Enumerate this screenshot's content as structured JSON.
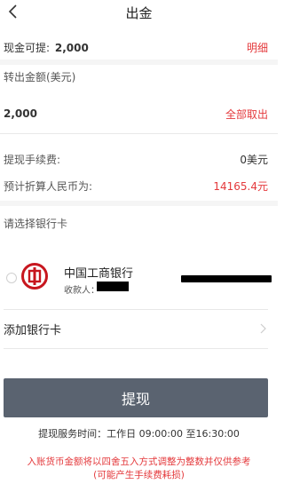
{
  "header": {
    "title": "出金"
  },
  "cash_row": {
    "label": "现金可提:",
    "amount": "2,000",
    "detail_link": "明细"
  },
  "transfer_amount": {
    "label": "转出金额(美元)",
    "value": "2,000",
    "withdraw_all": "全部取出"
  },
  "fee_row": {
    "label": "提现手续费:",
    "value": "0美元"
  },
  "rmb_row": {
    "label": "预计折算人民币为:",
    "value": "14165.4元"
  },
  "bank_section": {
    "label": "请选择银行卡"
  },
  "bank_card": {
    "name": "中国工商银行",
    "payee_label": "收款人："
  },
  "add_card": {
    "label": "添加银行卡"
  },
  "submit": {
    "label": "提现"
  },
  "notes": {
    "service_time": "提现服务时间：工作日 09:00:00 至16:30:00",
    "rounding_line1": "入账货币金额将以四舍五入方式调整为整数并仅供参考",
    "rounding_line2": "(可能产生手续费耗损)"
  },
  "colors": {
    "accent_red": "#e4393c",
    "button_bg": "#5a6370"
  }
}
